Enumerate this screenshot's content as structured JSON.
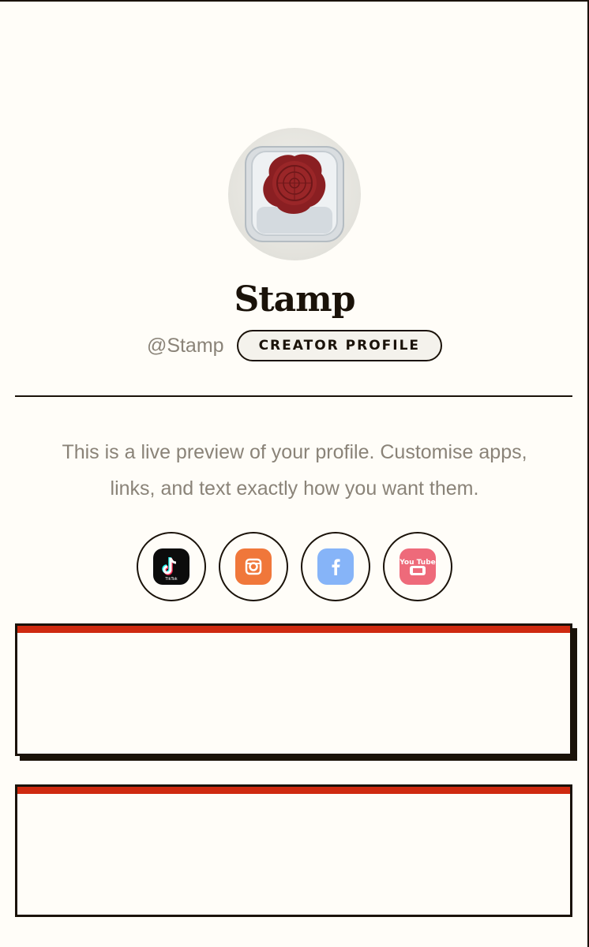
{
  "profile": {
    "name": "Stamp",
    "handle": "@Stamp",
    "badge_label": "CREATOR PROFILE",
    "bio": "This is a live preview of your profile. Customise apps, links, and text exactly how you want them."
  },
  "socials": [
    {
      "name": "TikTok",
      "icon": "tiktok-icon",
      "color": "#0c0c0c",
      "tile_text": "TikTok"
    },
    {
      "name": "Instagram",
      "icon": "instagram-icon",
      "color": "#f0773a"
    },
    {
      "name": "Facebook",
      "icon": "facebook-icon",
      "color": "#86b4f8"
    },
    {
      "name": "YouTube",
      "icon": "youtube-icon",
      "color": "#ee6a7a",
      "tile_text": "You Tube"
    }
  ],
  "colors": {
    "background": "#fffdf8",
    "ink": "#1a1209",
    "accent": "#cf2a10",
    "muted_text": "#8a8378"
  }
}
